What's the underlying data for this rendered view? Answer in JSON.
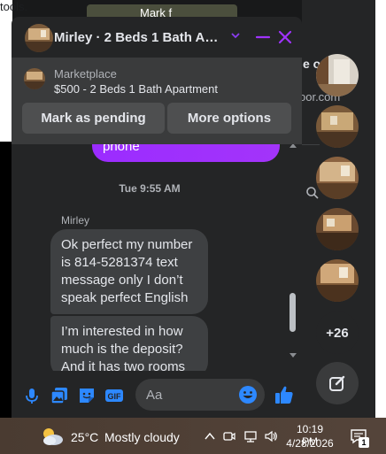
{
  "background": {
    "left_text": "tools.",
    "top_thumb_text": "Mark f",
    "right_text_1": "e or",
    "right_text_2": "oor.com"
  },
  "chat": {
    "title": "Mirley · 2 Beds 1 Bath Apa...",
    "accent_color": "#a033ff",
    "marketplace": {
      "label": "Marketplace",
      "title": "$500 - 2 Beds 1 Bath Apartment",
      "mark_pending_label": "Mark as pending",
      "more_options_label": "More options"
    },
    "outgoing_partial": "phone",
    "timestamp": "Tue 9:55 AM",
    "sender_name": "Mirley",
    "messages": [
      "Ok perfect my number is 814-5281374 text message only I don’t speak perfect English",
      "I’m interested in how much is the deposit? And it has two rooms"
    ],
    "composer_placeholder": "Aa"
  },
  "chat_heads": {
    "more_count": "+26"
  },
  "taskbar": {
    "temperature": "25°C",
    "condition": "Mostly cloudy",
    "time": "10:19 PM",
    "date": "4/28/2026",
    "notification_count": "1"
  }
}
